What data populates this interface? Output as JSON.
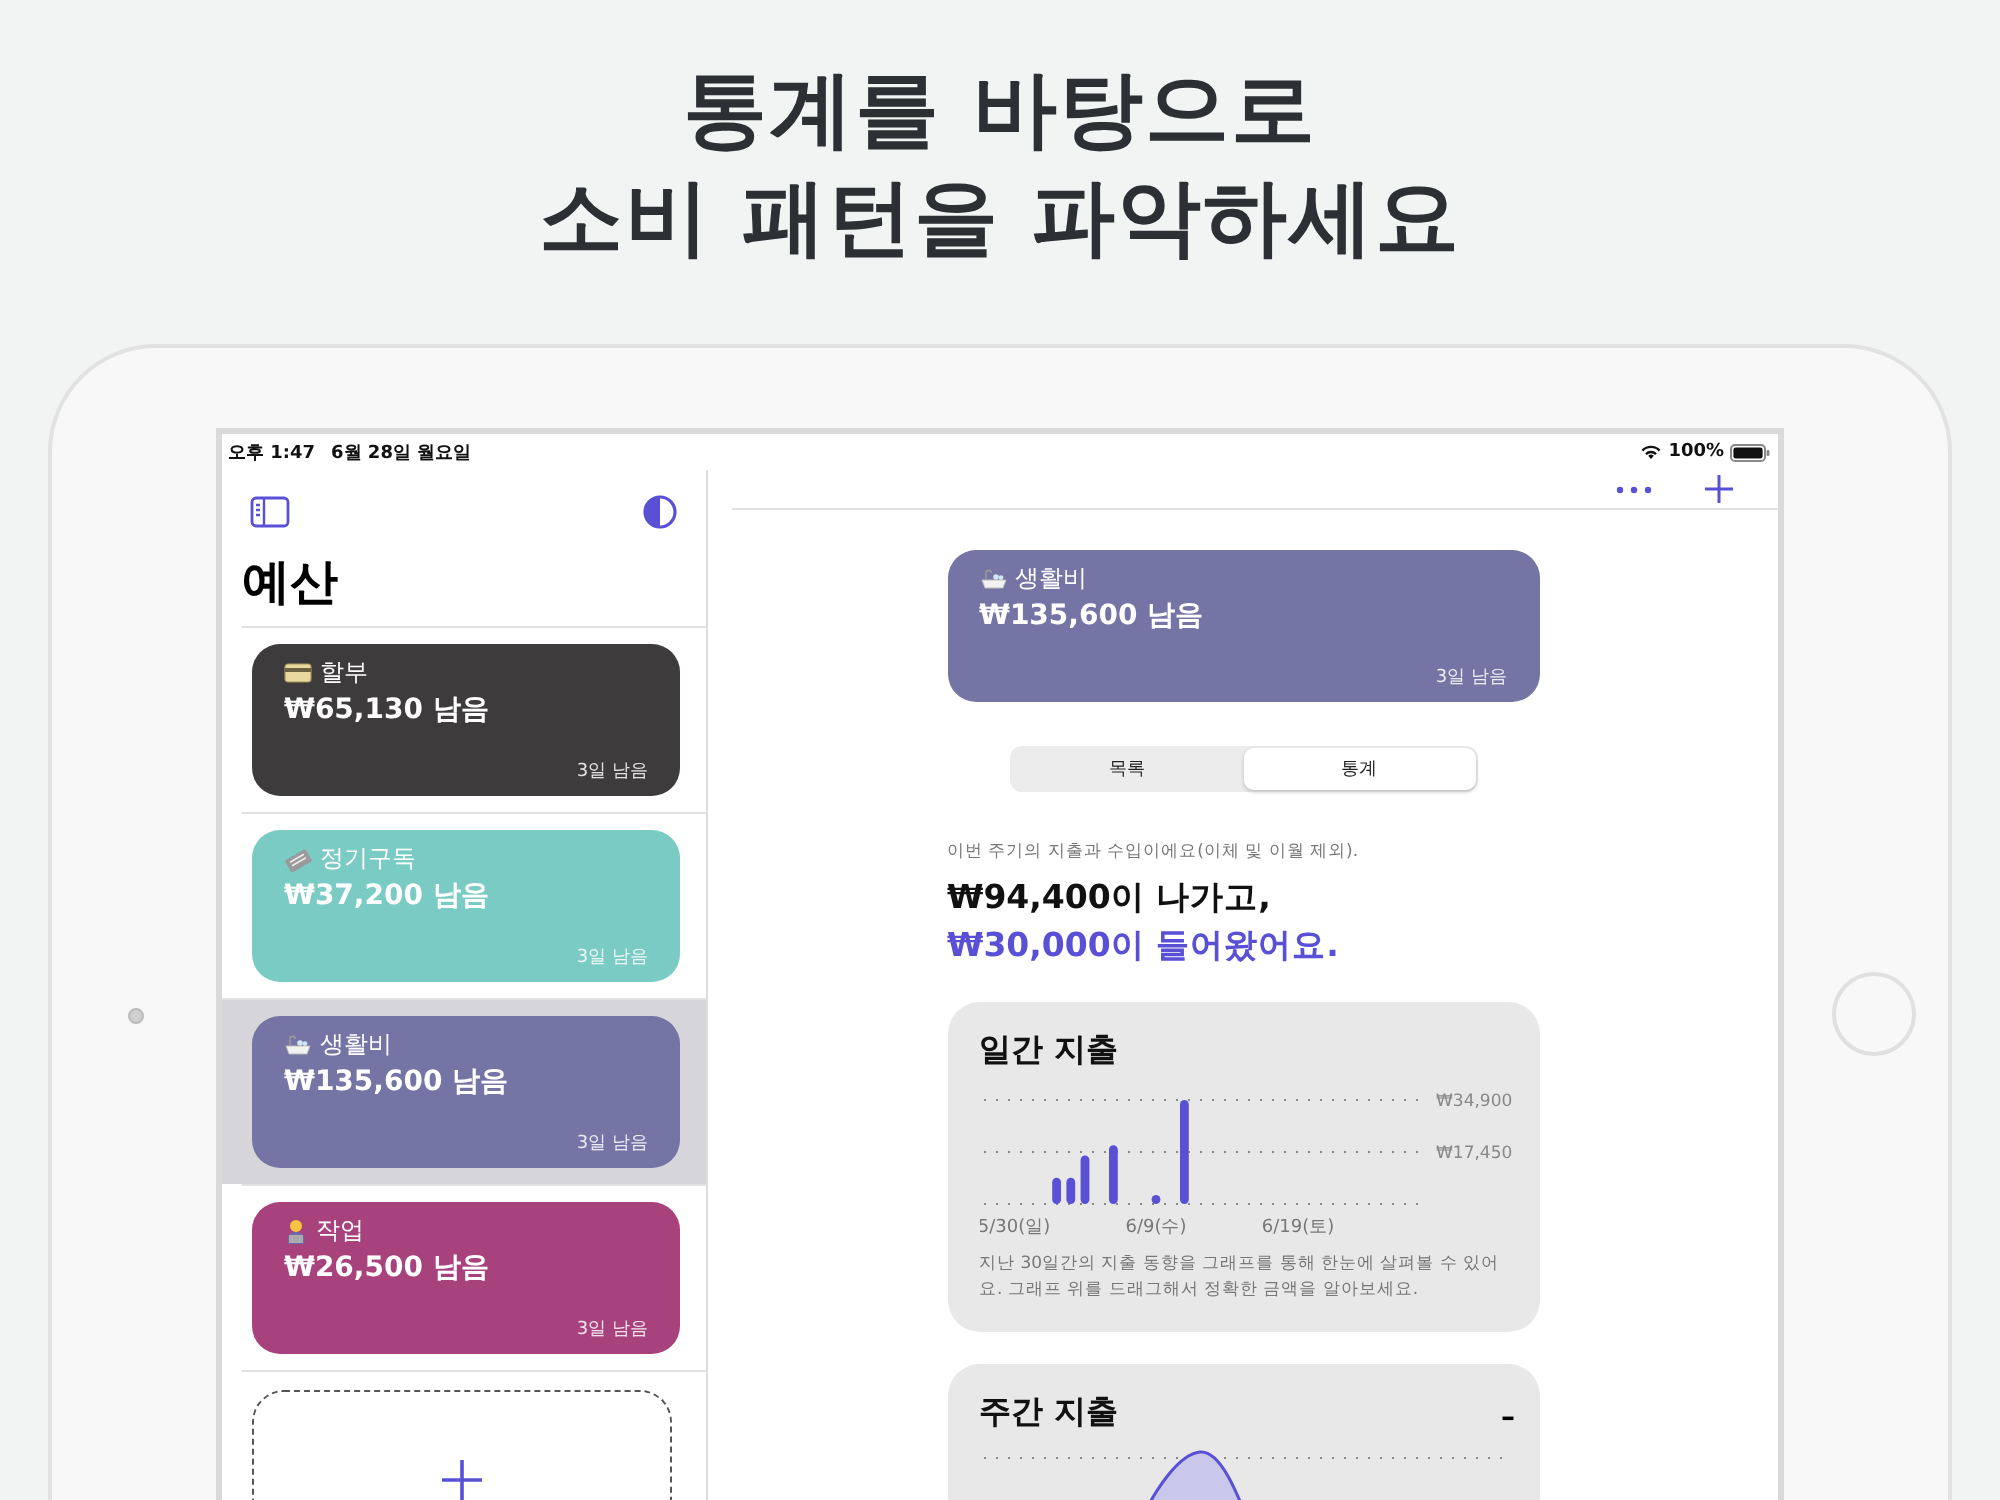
{
  "headline": [
    "통계를 바탕으로",
    "소비 패턴을 파악하세요"
  ],
  "status_bar": {
    "time": "오후 1:47",
    "date": "6월 28일 월요일",
    "battery": "100%"
  },
  "sidebar": {
    "title": "예산",
    "budgets": [
      {
        "kind": "card",
        "name": "할부",
        "amount": "₩65,130 남음",
        "remaining": "3일 남음",
        "color": "#3d3b3c",
        "selected": false
      },
      {
        "kind": "newspaper",
        "name": "정기구독",
        "amount": "₩37,200 남음",
        "remaining": "3일 남음",
        "color": "#7acbc3",
        "selected": false
      },
      {
        "kind": "bath",
        "name": "생활비",
        "amount": "₩135,600 남음",
        "remaining": "3일 남음",
        "color": "#7474a5",
        "selected": true
      },
      {
        "kind": "worker",
        "name": "작업",
        "amount": "₩26,500 남음",
        "remaining": "3일 남음",
        "color": "#a8427d",
        "selected": false
      }
    ]
  },
  "detail": {
    "budget": {
      "kind": "bath",
      "name": "생활비",
      "amount": "₩135,600 남음",
      "remaining": "3일 남음",
      "color": "#7474a5"
    },
    "tabs": [
      {
        "label": "목록",
        "selected": false
      },
      {
        "label": "통계",
        "selected": true
      }
    ],
    "caption": "이번 주기의 지출과 수입이에요(이체 및 이월 제외).",
    "spent": "₩94,400이 나가고,",
    "income": "₩30,000이 들어왔어요.",
    "daily_card": {
      "title": "일간 지출",
      "description": "지난 30일간의 지출 동향을 그래프를 통해 한눈에 살펴볼 수 있어요. 그래프 위를 드래그해서 정확한 금액을 알아보세요.",
      "chart_data": {
        "type": "bar",
        "categories": [
          "5/30(일)",
          null,
          null,
          null,
          null,
          null,
          null,
          null,
          null,
          null,
          "6/9(수)",
          null,
          null,
          null,
          null,
          null,
          null,
          null,
          null,
          null,
          "6/19(토)",
          null,
          null,
          null,
          null,
          null,
          null,
          null,
          null,
          null
        ],
        "series": [
          {
            "color": "#5a50d6",
            "values": [
              null,
              null,
              null,
              8800,
              8800,
              16300,
              null,
              19700,
              null,
              null,
              3000,
              null,
              34900,
              null,
              null,
              null,
              null,
              null,
              null,
              null,
              null,
              null,
              null,
              null,
              null,
              null,
              null,
              null,
              null,
              null
            ]
          }
        ],
        "ylim": [
          0,
          34900
        ],
        "yticks": [
          {
            "value": 17450,
            "label": "₩17,450"
          },
          {
            "value": 34900,
            "label": "₩34,900"
          }
        ]
      }
    },
    "weekly_card": {
      "title": "주간 지출",
      "tick": "–"
    }
  }
}
